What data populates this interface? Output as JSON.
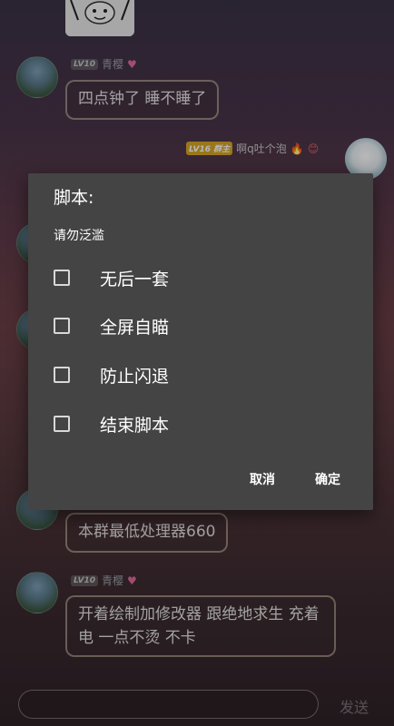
{
  "chat": {
    "messages": [
      {
        "user_level": "LV10",
        "user_name": "青樱",
        "text": "四点钟了 睡不睡了"
      },
      {
        "user_level": "LV16",
        "role": "群主",
        "user_name": "啊q吐个泡",
        "text": ""
      },
      {
        "user_level": "",
        "user_name": "",
        "text": "本群最低处理器660"
      },
      {
        "user_level": "LV10",
        "user_name": "青樱",
        "text": "开着绘制加修改器 跟绝地求生 充着电 一点不烫 不卡"
      }
    ],
    "input_placeholder": "",
    "send_label": "发送"
  },
  "dialog": {
    "title": "脚本:",
    "message": "请勿泛滥",
    "options": [
      {
        "label": "无后一套",
        "checked": false
      },
      {
        "label": "全屏自瞄",
        "checked": false
      },
      {
        "label": "防止闪退",
        "checked": false
      },
      {
        "label": "结束脚本",
        "checked": false
      }
    ],
    "cancel_label": "取消",
    "confirm_label": "确定"
  }
}
